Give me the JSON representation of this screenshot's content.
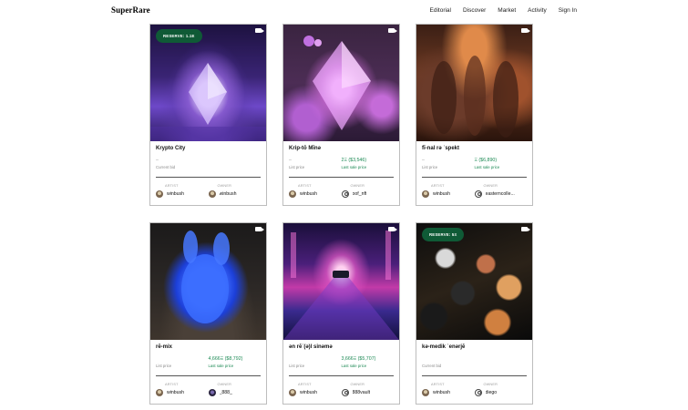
{
  "header": {
    "logo": "SuperRare",
    "nav": [
      "Editorial",
      "Discover",
      "Market",
      "Activity",
      "Sign In"
    ]
  },
  "labels": {
    "artist": "ARTIST",
    "owner": "OWNER"
  },
  "cards": [
    {
      "title": "Krypto City",
      "badge": "RESERVE: 1.1E",
      "price_primary": "–",
      "price_primary_sub": "Current bid",
      "price_secondary": "",
      "price_secondary_sub": "",
      "artist": "winbush",
      "owner": "winbush"
    },
    {
      "title": "Krip-tō Mīnə",
      "badge": "",
      "price_primary": "–",
      "price_primary_sub": "List price",
      "price_secondary": "2Ξ ($3,546)",
      "price_secondary_sub": "Last sale price",
      "artist": "winbush",
      "owner": "oof_nft"
    },
    {
      "title": "fī-nal rə ˈspekt",
      "badge": "",
      "price_primary": "–",
      "price_primary_sub": "List price",
      "price_secondary": "Ξ ($6,890)",
      "price_secondary_sub": "Last sale price",
      "artist": "winbush",
      "owner": "easterncolle..."
    },
    {
      "title": "rē-mix",
      "badge": "",
      "price_primary": "",
      "price_primary_sub": "List price",
      "price_secondary": "4,666Ξ ($8,792)",
      "price_secondary_sub": "Last sale price",
      "artist": "winbush",
      "owner": "_888_"
    },
    {
      "title": "ən rēˈ(ə)l sinəmə",
      "badge": "",
      "price_primary": "",
      "price_primary_sub": "List price",
      "price_secondary": "3,666Ξ ($5,707)",
      "price_secondary_sub": "Last sale price",
      "artist": "winbush",
      "owner": "888vault"
    },
    {
      "title": "kə-medik ˈenərjē",
      "badge": "RESERVE: 5Ξ",
      "price_primary": "",
      "price_primary_sub": "Current bid",
      "price_secondary": "",
      "price_secondary_sub": "",
      "artist": "winbush",
      "owner": "diego"
    }
  ]
}
